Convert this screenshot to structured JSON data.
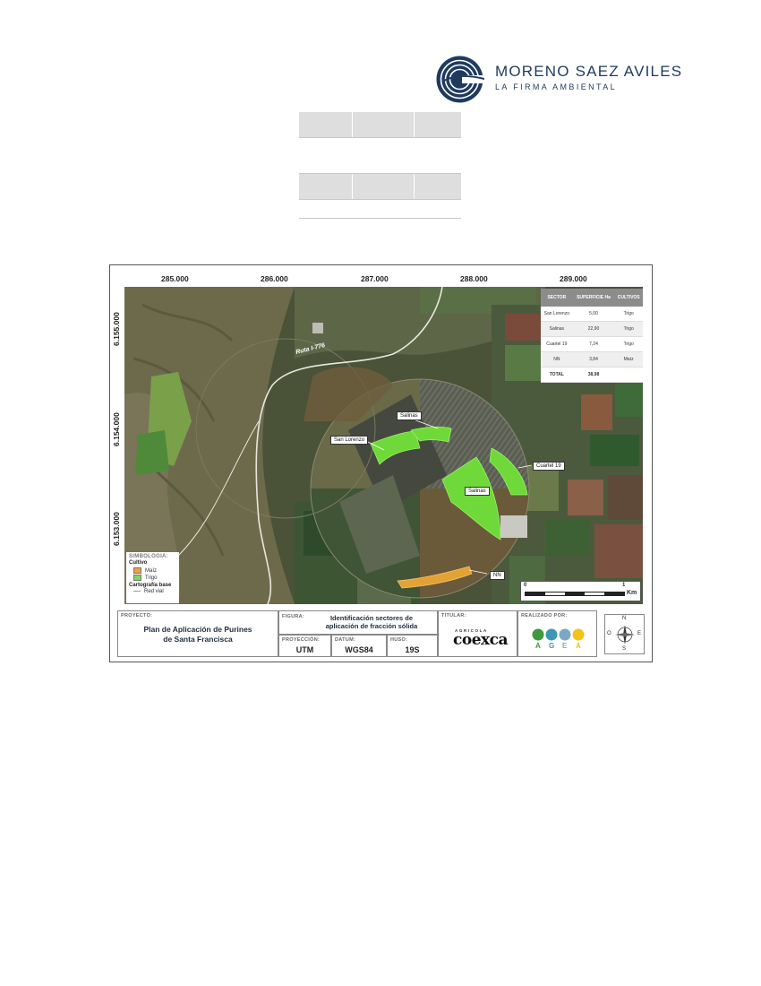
{
  "header": {
    "company_name": "MORENO SAEZ AVILES",
    "company_tagline": "LA FIRMA AMBIENTAL",
    "logo_icon": "concentric-waves-logo"
  },
  "map": {
    "x_ticks": [
      "285.000",
      "286.000",
      "287.000",
      "288.000",
      "289.000"
    ],
    "y_ticks": [
      "6.155.000",
      "6.154.000",
      "6.153.000"
    ],
    "road_label": "Ruta I-776",
    "sector_labels": [
      "Salinas",
      "San Lorenzo",
      "Cuartel 19",
      "Salinas",
      "NN"
    ],
    "table": {
      "headers": [
        "SECTOR",
        "SUPERFICIE Ha",
        "CULTIVOS"
      ],
      "rows": [
        [
          "San Lorenzo",
          "5,00",
          "Trigo"
        ],
        [
          "Salinas",
          "22,90",
          "Trigo"
        ],
        [
          "Cuartel 19",
          "7,24",
          "Trigo"
        ],
        [
          "NN",
          "3,84",
          "Maíz"
        ]
      ],
      "total_label": "TOTAL",
      "total_value": "38,98"
    },
    "legend": {
      "title": "SIMBOLOGIA:",
      "group1": "Cultivo",
      "items": [
        {
          "label": "Maíz",
          "color": "#e8a447"
        },
        {
          "label": "Trigo",
          "color": "#7ed957"
        }
      ],
      "group2": "Cartografía base",
      "road": "Red vial"
    },
    "scale": {
      "start": "0",
      "end": "1",
      "unit": "Km"
    },
    "colors": {
      "trigo": "#6fd93a",
      "maiz": "#e3a234"
    }
  },
  "title_block": {
    "proyecto_caption": "PROYECTO:",
    "proyecto_line1": "Plan de Aplicación de Purines",
    "proyecto_line2": "de Santa Francisca",
    "figura_caption": "FIGURA:",
    "figura_line1": "Identificación sectores de",
    "figura_line2": "aplicación de fracción sólida",
    "titular_caption": "TITULAR:",
    "titular_small": "AGRICOLA",
    "titular_name": "coexca",
    "realizado_caption": "REALIZADO POR:",
    "agea_letters": [
      "A",
      "G",
      "E",
      "A"
    ],
    "proyeccion_caption": "PROYECCIÓN:",
    "proyeccion_value": "UTM",
    "datum_caption": "DATUM:",
    "datum_value": "WGS84",
    "huso_caption": "HUSO:",
    "huso_value": "19S",
    "compass": {
      "n": "N",
      "s": "S",
      "e": "E",
      "o": "O"
    }
  }
}
